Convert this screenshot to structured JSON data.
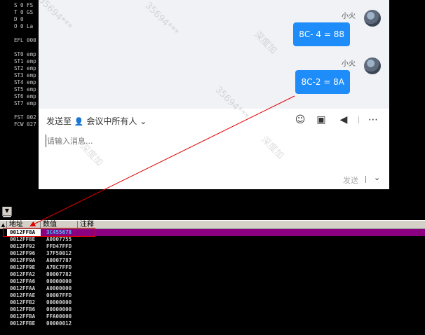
{
  "registers": {
    "rows": [
      "S 0  FS",
      "T 0  GS",
      "D 0",
      "O 0  La",
      "",
      "EFL 000",
      "",
      "ST0 emp",
      "ST1 emp",
      "ST2 emp",
      "ST3 emp",
      "ST4 emp",
      "ST5 emp",
      "ST6 emp",
      "ST7 emp",
      "",
      "FST 002",
      "FCW 027"
    ]
  },
  "chat": {
    "messages": [
      {
        "sender": "小火",
        "text": "8C- 4 = 88"
      },
      {
        "sender": "小火",
        "text": "8C-2 = 8A"
      }
    ],
    "send_to_label": "发送至",
    "recipient": "会议中所有人",
    "input_placeholder": "请输入消息...",
    "send_label": "发送",
    "icons": {
      "emoji": "emoji-icon",
      "folder": "folder-icon",
      "announce": "megaphone-icon",
      "more": "more-icon"
    }
  },
  "dump": {
    "columns": [
      "地址",
      "数值",
      "注释"
    ],
    "rows": [
      {
        "addr": "0012FF8A",
        "val": "3C455678"
      },
      {
        "addr": "0012FF8E",
        "val": "A0007755"
      },
      {
        "addr": "0012FF92",
        "val": "FFD47FFD"
      },
      {
        "addr": "0012FF96",
        "val": "37F50012"
      },
      {
        "addr": "0012FF9A",
        "val": "A0007787"
      },
      {
        "addr": "0012FF9E",
        "val": "A7BC7FFD"
      },
      {
        "addr": "0012FFA2",
        "val": "00007782"
      },
      {
        "addr": "0012FFA6",
        "val": "00000000"
      },
      {
        "addr": "0012FFAA",
        "val": "A0000000"
      },
      {
        "addr": "0012FFAE",
        "val": "00007FFD"
      },
      {
        "addr": "0012FFB2",
        "val": "00000000"
      },
      {
        "addr": "0012FFB6",
        "val": "00000000"
      },
      {
        "addr": "0012FFBA",
        "val": "FFA00000"
      },
      {
        "addr": "0012FFBE",
        "val": "00000012"
      }
    ],
    "selected_index": 0
  },
  "watermark": [
    "35694***",
    "深度加"
  ]
}
